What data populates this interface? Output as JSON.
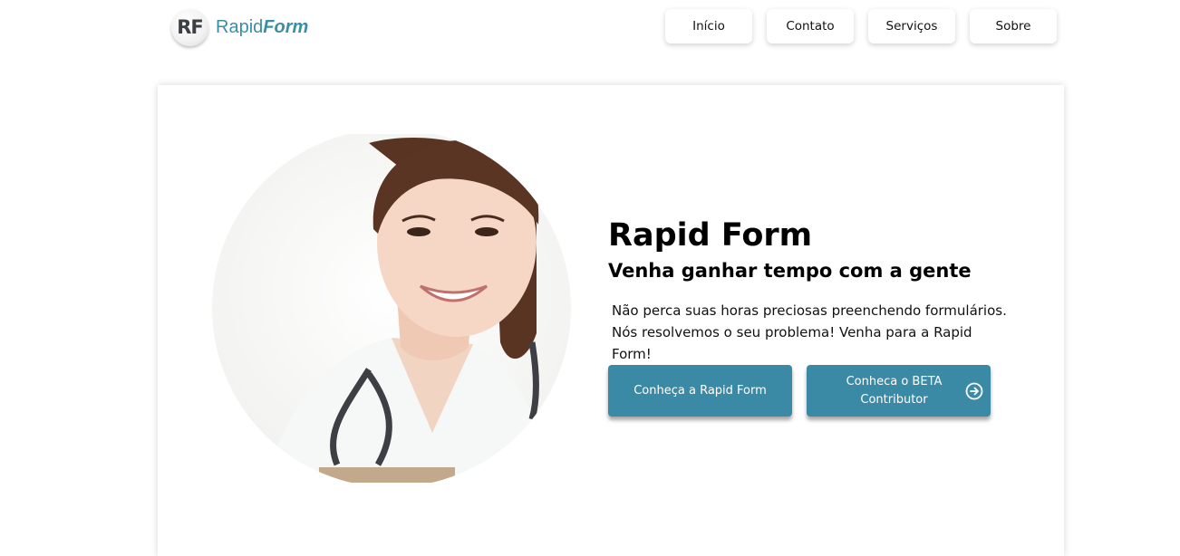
{
  "brand": {
    "badge": "RF",
    "name_regular": "Rapid",
    "name_bold": "Form"
  },
  "nav": {
    "items": [
      {
        "label": "Início"
      },
      {
        "label": "Contato"
      },
      {
        "label": "Serviços"
      },
      {
        "label": "Sobre"
      }
    ]
  },
  "hero": {
    "title": "Rapid Form",
    "subtitle": "Venha ganhar tempo com a gente",
    "description_line1": "Não perca suas horas preciosas preenchendo formulários.",
    "description_line2": "Nós resolvemos o seu problema! Venha para a Rapid Form!",
    "photo_icon": "doctor-photo",
    "primary_button": "Conheça a Rapid Form",
    "secondary_button": "Conheca o BETA Contributor",
    "secondary_button_icon": "arrow-right-circle-icon"
  },
  "colors": {
    "accent": "#3b8aa5",
    "logo_text": "#3a8ea6"
  }
}
